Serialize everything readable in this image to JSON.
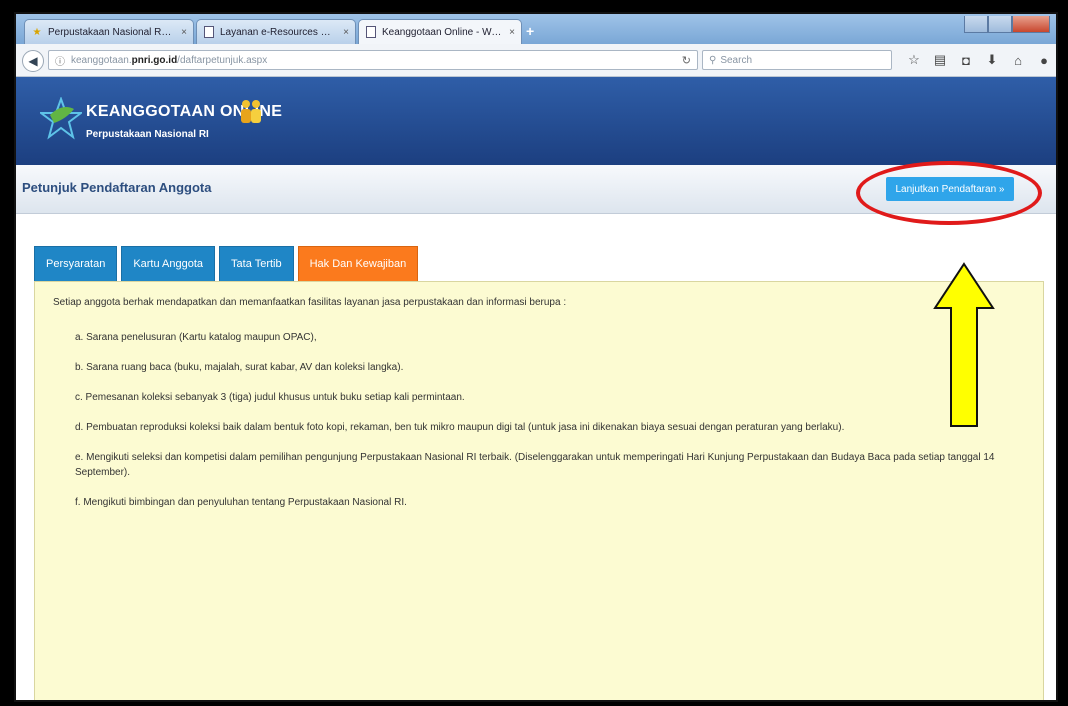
{
  "browser": {
    "tabs": [
      {
        "label": "Perpustakaan Nasional Rep...",
        "icon": "star-icon"
      },
      {
        "label": "Layanan e-Resources Perp...",
        "icon": "page-icon"
      },
      {
        "label": "Keanggotaan Online - Welcome",
        "icon": "page-icon"
      }
    ],
    "close_glyph": "×",
    "new_tab_glyph": "+",
    "url_prefix": "keanggotaan.",
    "url_domain": "pnri.go.id",
    "url_path": "/daftarpetunjuk.aspx",
    "search_placeholder": "Search"
  },
  "site": {
    "title": "KEANGGOTAAN ONLINE",
    "subtitle": "Perpustakaan Nasional RI"
  },
  "page": {
    "title": "Petunjuk Pendaftaran Anggota",
    "continue_button": "Lanjutkan Pendaftaran »"
  },
  "content_tabs": [
    {
      "label": "Persyaratan"
    },
    {
      "label": "Kartu Anggota"
    },
    {
      "label": "Tata Tertib"
    },
    {
      "label": "Hak Dan Kewajiban",
      "active": true
    }
  ],
  "content": {
    "intro": "Setiap anggota berhak mendapatkan dan memanfaatkan fasilitas layanan jasa perpustakaan dan informasi berupa :",
    "items": [
      "a. Sarana penelusuran (Kartu katalog maupun OPAC),",
      "b. Sarana ruang baca (buku, majalah, surat kabar, AV dan koleksi langka).",
      "c. Pemesanan koleksi sebanyak 3 (tiga) judul khusus untuk buku setiap kali permintaan.",
      "d. Pembuatan reproduksi koleksi baik dalam bentuk foto kopi, rekaman, ben tuk mikro maupun digi tal (untuk jasa ini dikenakan biaya sesuai dengan peraturan yang berlaku).",
      "e. Mengikuti seleksi dan kompetisi dalam pemilihan pengunjung Perpustakaan Nasional RI terbaik. (Diselenggarakan untuk memperingati Hari Kunjung Perpustakaan dan Budaya Baca pada setiap tanggal 14 September).",
      "f. Mengikuti bimbingan dan penyuluhan tentang Perpustakaan Nasional RI."
    ]
  },
  "colors": {
    "header_blue": "#1c3f80",
    "tab_blue": "#1f86c6",
    "tab_active_orange": "#fb7a1d",
    "button_blue": "#2fa5ea",
    "panel_bg": "#fcfbd2",
    "highlight_red": "#e01a1a",
    "arrow_yellow": "#ffff00"
  }
}
